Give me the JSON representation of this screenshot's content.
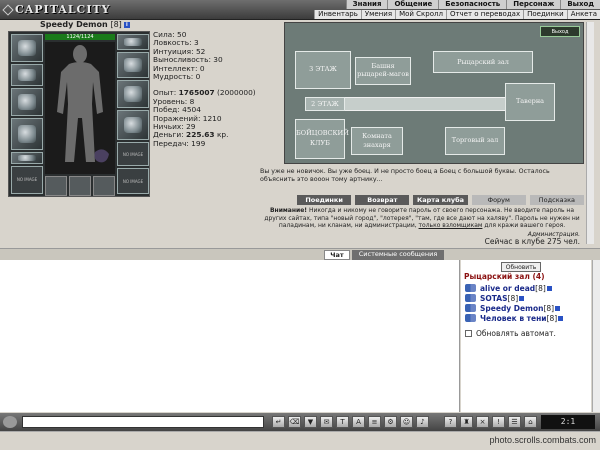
{
  "header": {
    "logo_text": "CAPITALCITY",
    "main_nav": [
      "Знания",
      "Общение",
      "Безопасность",
      "Персонаж",
      "Выход"
    ],
    "sub_nav": [
      "Инвентарь",
      "Умения",
      "Мой Скролл",
      "Отчет о переводах",
      "Поединки",
      "Анкета"
    ]
  },
  "character": {
    "name": "Speedy Demon",
    "level": "[8]",
    "hp": "1124/1124",
    "empty_slot_label": "NO IMAGE",
    "stats": {
      "strength": "Сила: 50",
      "agility": "Ловкость: 3",
      "intuition": "Интуиция: 52",
      "endurance": "Выносливость: 30",
      "intellect": "Интеллект: 0",
      "wisdom": "Мудрость: 0"
    },
    "progress": {
      "exp_label": "Опыт:",
      "exp_value": "1765007",
      "exp_next": "(2000000)",
      "level": "Уровень: 8",
      "wins": "Побед: 4504",
      "losses": "Поражений: 1210",
      "draws": "Ничьих: 29",
      "money_label": "Деньги:",
      "money_value": "225.63",
      "money_unit": "кр.",
      "transfers": "Передач: 199"
    }
  },
  "map": {
    "rooms": {
      "floor3": "3 ЭТАЖ",
      "tower": "Башня рыцарей-магов",
      "knights_hall": "Рыцарский зал",
      "floor2": "2 ЭТАЖ",
      "tavern": "Таверна",
      "fight_club": "БОЙЦОВСКИЙ КЛУБ",
      "newbie_room": "Комната знахаря",
      "trade_hall": "Торговый зал"
    },
    "exit_label": "Выход"
  },
  "description": "Вы уже не новичок. Вы уже боец. И не просто боец а Боец с большой буквы. Осталось объяснить это вооон тому артнику...",
  "actions": {
    "fights": "Поединки",
    "back": "Возврат",
    "club_map": "Карта клуба",
    "forum": "Форум",
    "hint": "Подсказка"
  },
  "warning": {
    "title": "Внимание!",
    "text": "Никогда и никому не говорите пароль от своего персонажа. Не вводите пароль на других сайтах, типа \"новый город\", \"лотерея\", \"там, где все дают на халяву\". Пароль не нужен ни паладинам, ни кланам, ни администрации,",
    "link": "только взломщикам",
    "tail": "для кражи вашего героя.",
    "signature": "Администрация."
  },
  "online": "Сейчас в клубе 275 чел.",
  "tabs": {
    "chat": "Чат",
    "system": "Системные сообщения"
  },
  "room_panel": {
    "refresh": "Обновить",
    "title": "Рыцарский зал (4)",
    "users": [
      {
        "name": "alive or dead",
        "level": "[8]"
      },
      {
        "name": "SOTAS",
        "level": "[8]"
      },
      {
        "name": "Speedy Demon",
        "level": "[8]"
      },
      {
        "name": "Человек в тени",
        "level": "[8]"
      }
    ],
    "auto_refresh": "Обновлять автомат."
  },
  "toolbar": {
    "clock": "2:1"
  },
  "watermark": "photo.scrolls.combats.com"
}
